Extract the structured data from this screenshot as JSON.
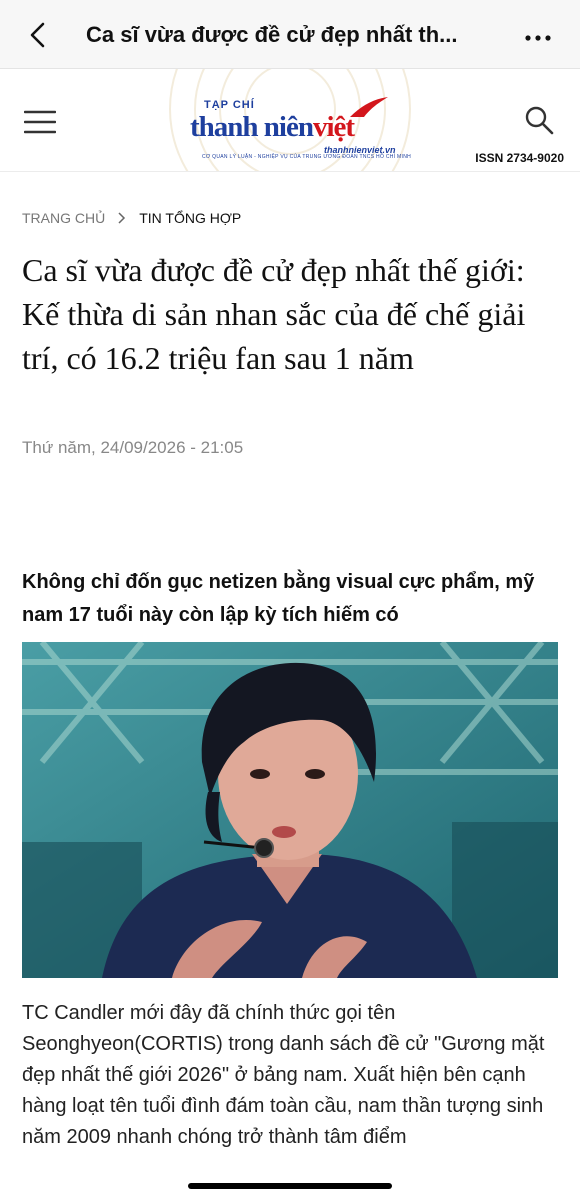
{
  "topbar": {
    "title": "Ca sĩ vừa được đề cử đẹp nhất th...",
    "back_icon": "chevron-left-icon",
    "more_icon": "more-horizontal-icon"
  },
  "site_header": {
    "menu_icon": "hamburger-menu-icon",
    "search_icon": "search-icon",
    "logo": {
      "kicker": "TẠP CHÍ",
      "name_part1": "thanh niên",
      "name_part2": "việt",
      "url": "thanhnienviet.vn",
      "tagline": "CƠ QUAN LÝ LUẬN - NGHIỆP VỤ CỦA TRUNG ƯƠNG ĐOÀN TNCS HỒ CHÍ MINH"
    },
    "issn": "ISSN 2734-9020",
    "colors": {
      "brand_blue": "#1e3f9e",
      "brand_red": "#d3161c"
    }
  },
  "breadcrumb": {
    "home": "TRANG CHỦ",
    "current": "TIN TỔNG HỢP"
  },
  "article": {
    "headline": "Ca sĩ vừa được đề cử đẹp nhất thế giới: Kế thừa di sản nhan sắc của đế chế giải trí, có 16.2 triệu fan sau 1 năm",
    "date": "Thứ năm, 24/09/2026 - 21:05",
    "sapo": "Không chỉ đốn gục netizen bằng visual cực phẩm, mỹ nam 17 tuổi này còn lập kỳ tích hiếm có",
    "body": "TC Candler mới đây đã chính thức gọi tên Seonghyeon(CORTIS) trong danh sách đề cử \"Gương mặt đẹp nhất thế giới 2026\" ở bảng nam. Xuất hiện bên cạnh hàng loạt tên tuổi đình đám toàn cầu, nam thần tượng sinh năm 2009 nhanh chóng trở thành tâm điểm"
  }
}
